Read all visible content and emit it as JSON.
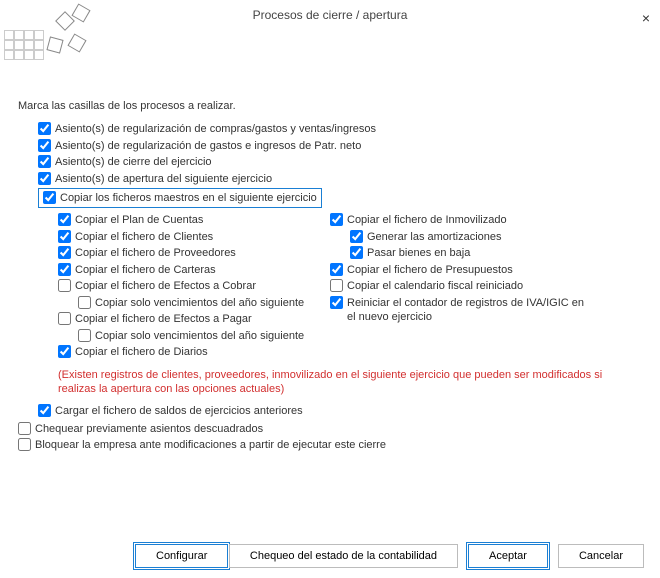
{
  "title": "Procesos de cierre / apertura",
  "instruction": "Marca las casillas de los procesos a realizar.",
  "c": {
    "regCompras": "Asiento(s) de regularización de compras/gastos y ventas/ingresos",
    "regPatr": "Asiento(s) de regularización de gastos e ingresos de Patr. neto",
    "cierre": "Asiento(s) de cierre del ejercicio",
    "apertura": "Asiento(s) de apertura del siguiente ejercicio",
    "copiarMaestros": "Copiar los ficheros maestros en el siguiente ejercicio",
    "plan": "Copiar el Plan de Cuentas",
    "clientes": "Copiar el fichero de Clientes",
    "prov": "Copiar el fichero de Proveedores",
    "carteras": "Copiar el fichero de Carteras",
    "efCobrar": "Copiar el fichero de Efectos a Cobrar",
    "venc1": "Copiar solo vencimientos del año siguiente",
    "efPagar": "Copiar el fichero de Efectos a Pagar",
    "venc2": "Copiar solo vencimientos del año siguiente",
    "diarios": "Copiar el fichero de Diarios",
    "inmov": "Copiar el fichero de Inmovilizado",
    "amort": "Generar las amortizaciones",
    "bienes": "Pasar bienes en baja",
    "presup": "Copiar el fichero de Presupuestos",
    "calFiscal": "Copiar el calendario fiscal reiniciado",
    "resetIva": "Reiniciar el contador de registros de IVA/IGIC en el nuevo ejercicio",
    "saldos": "Cargar el fichero de saldos de ejercicios anteriores",
    "chequear": "Chequear previamente asientos descuadrados",
    "bloquear": "Bloquear la empresa ante modificaciones a partir de ejecutar este cierre"
  },
  "warning": "(Existen registros de clientes, proveedores, inmovilizado en el siguiente ejercicio que pueden ser modificados si realizas la apertura con las opciones actuales)",
  "buttons": {
    "configurar": "Configurar",
    "chequeo": "Chequeo del estado de la contabilidad",
    "aceptar": "Aceptar",
    "cancelar": "Cancelar"
  }
}
